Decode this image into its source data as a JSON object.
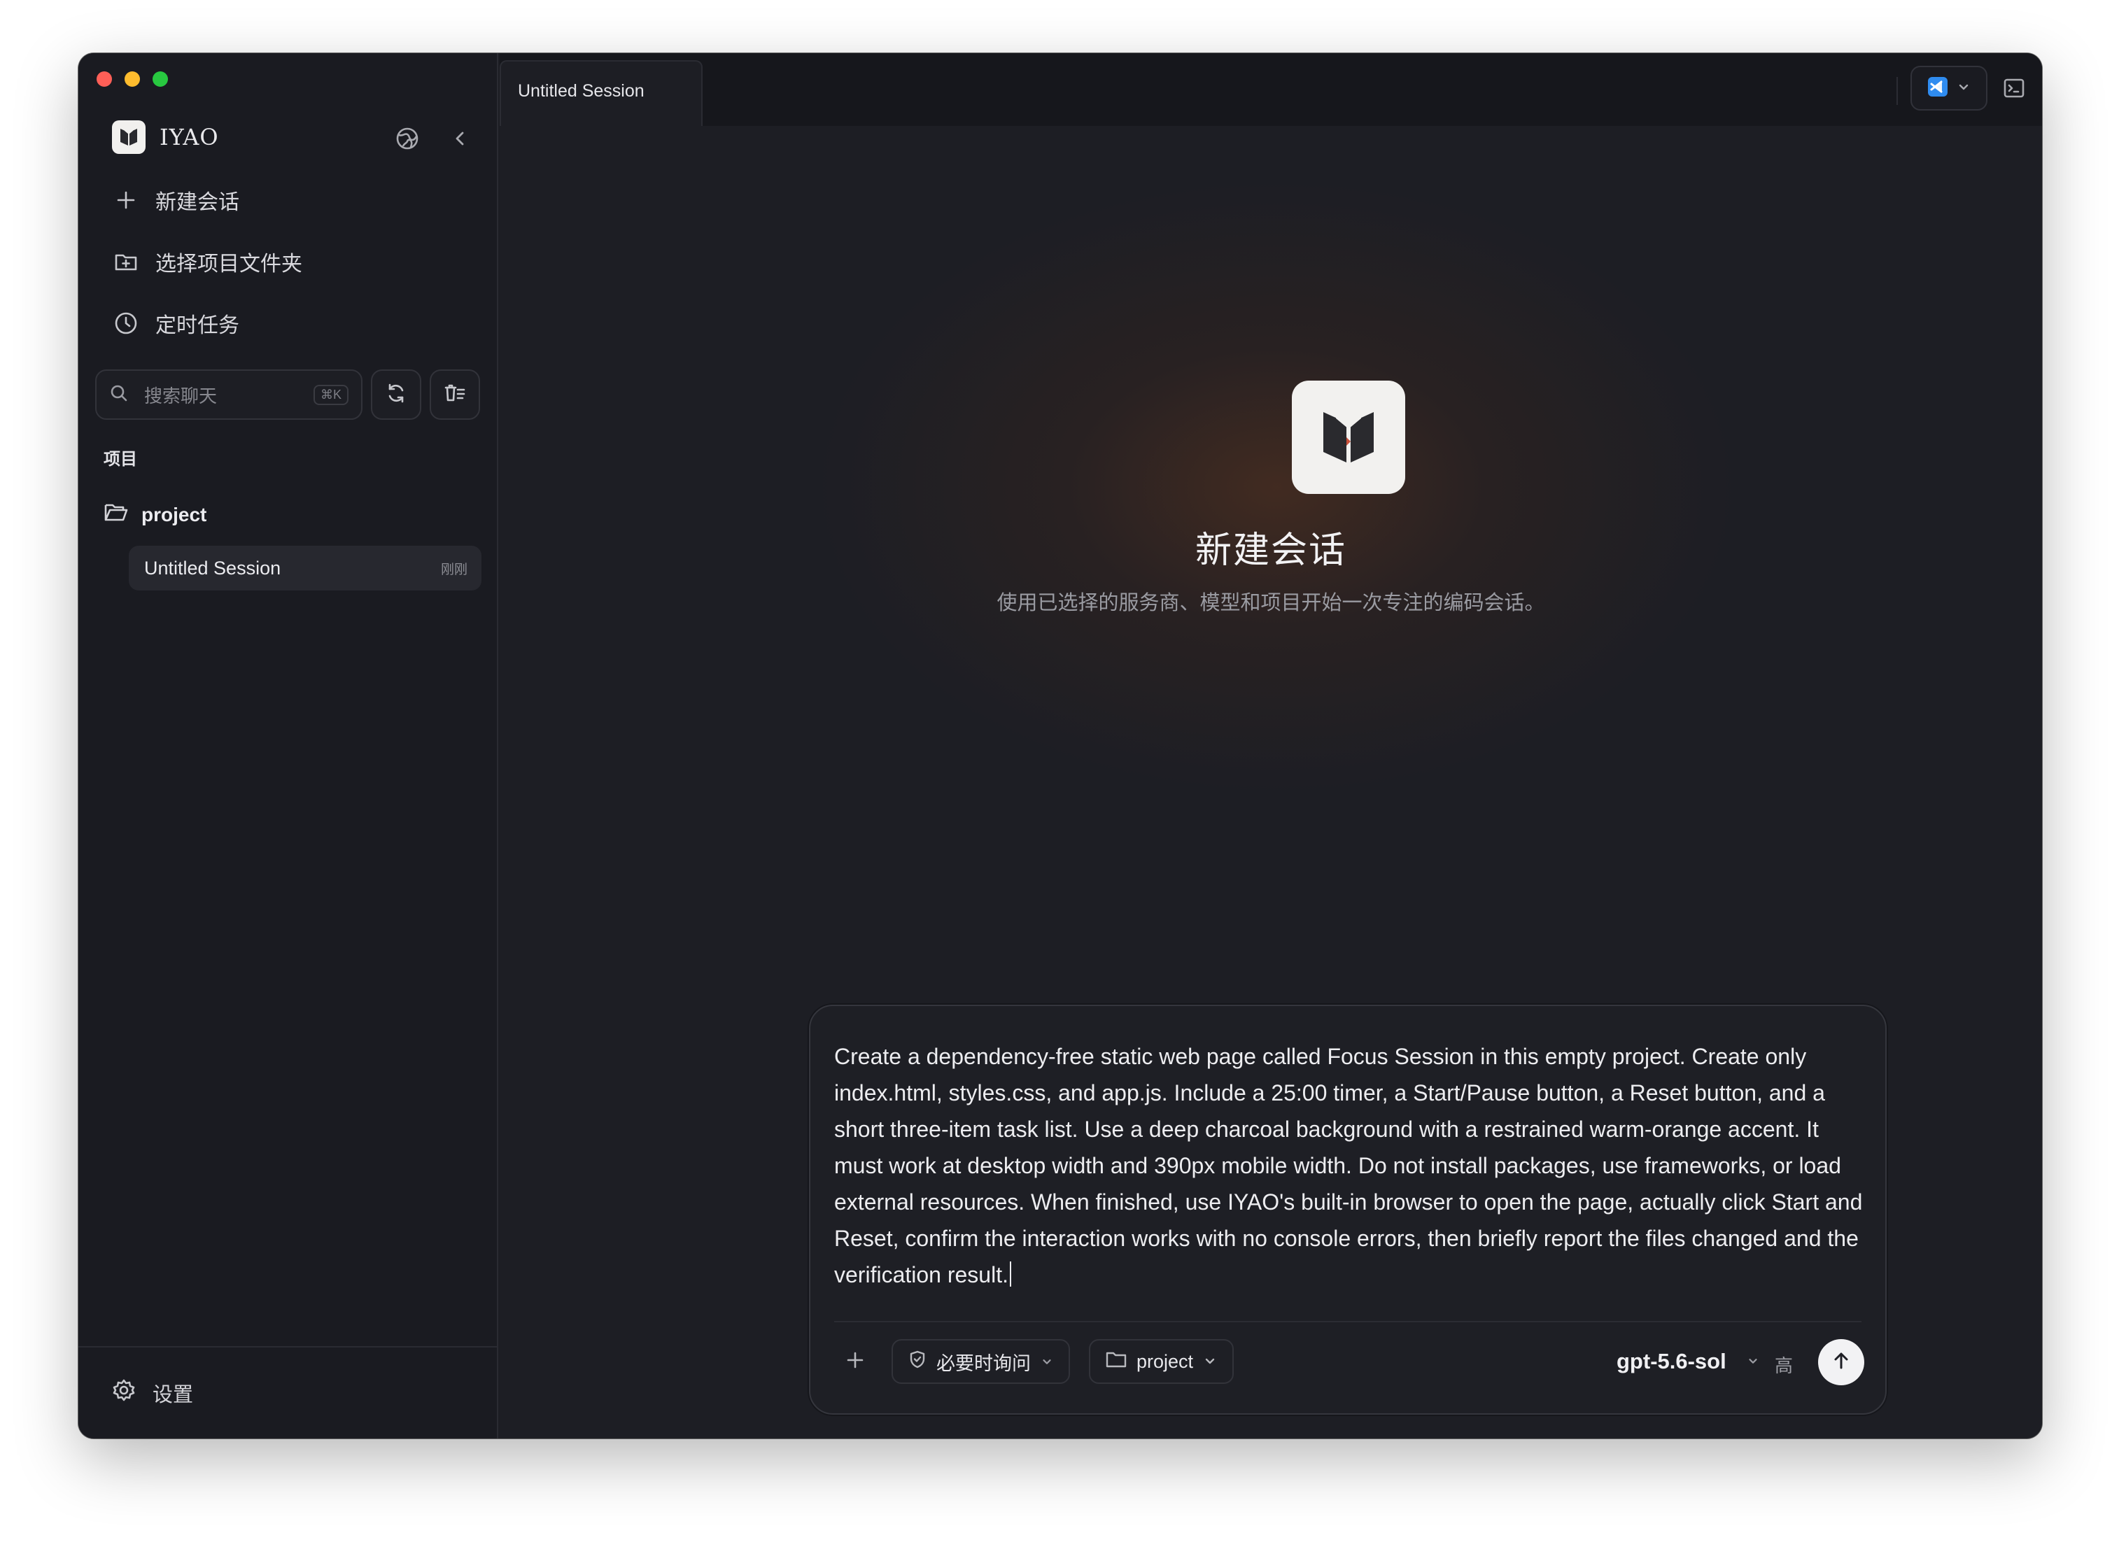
{
  "app": {
    "name": "IYAO"
  },
  "sidebar": {
    "nav": [
      {
        "label": "新建会话",
        "icon": "plus-icon"
      },
      {
        "label": "选择项目文件夹",
        "icon": "folder-plus-icon"
      },
      {
        "label": "定时任务",
        "icon": "clock-icon"
      }
    ],
    "search": {
      "placeholder": "搜索聊天",
      "shortcut": "⌘K"
    },
    "section_label": "项目",
    "project": {
      "name": "project",
      "icon": "folder-open-icon"
    },
    "sessions": [
      {
        "title": "Untitled Session",
        "time": "刚刚"
      }
    ],
    "settings_label": "设置"
  },
  "tabs": [
    {
      "label": "Untitled Session"
    }
  ],
  "hero": {
    "title": "新建会话",
    "subtitle": "使用已选择的服务商、模型和项目开始一次专注的编码会话。"
  },
  "composer": {
    "prompt": "Create a dependency-free static web page called Focus Session in this empty project. Create only index.html, styles.css, and app.js. Include a 25:00 timer, a Start/Pause button, a Reset button, and a short three-item task list. Use a deep charcoal background with a restrained warm-orange accent. It must work at desktop width and 390px mobile width. Do not install packages, use frameworks, or load external resources. When finished, use IYAO's built-in browser to open the page, actually click Start and Reset, confirm the interaction works with no console errors, then briefly report the files changed and the verification result.",
    "permission": "必要时询问",
    "project": "project",
    "model": "gpt-5.6-sol",
    "effort": "高"
  },
  "colors": {
    "window_bg": "#1c1d23",
    "sidebar_bg": "#1a1b21",
    "accent_glow": "#783e1c",
    "vscode_blue": "#2f8cf0"
  }
}
